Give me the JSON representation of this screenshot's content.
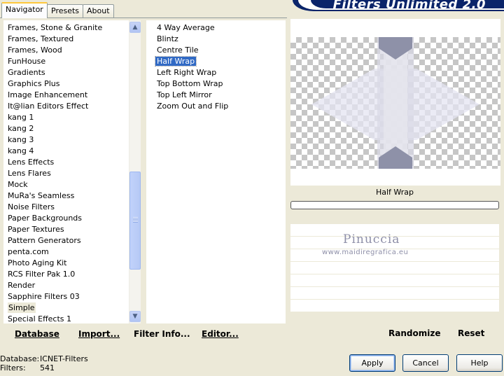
{
  "tabs": [
    {
      "label": "Navigator",
      "active": true
    },
    {
      "label": "Presets",
      "active": false
    },
    {
      "label": "About",
      "active": false
    }
  ],
  "banner": {
    "title": "Filters Unlimited 2.0"
  },
  "categories": [
    "Frames, Stone & Granite",
    "Frames, Textured",
    "Frames, Wood",
    "FunHouse",
    "Gradients",
    "Graphics Plus",
    "Image Enhancement",
    "It@lian Editors Effect",
    "kang 1",
    "kang 2",
    "kang 3",
    "kang 4",
    "Lens Effects",
    "Lens Flares",
    "Mock",
    "MuRa's Seamless",
    "Noise Filters",
    "Paper Backgrounds",
    "Paper Textures",
    "Pattern Generators",
    "penta.com",
    "Photo Aging Kit",
    "RCS Filter Pak 1.0",
    "Render",
    "Sapphire Filters 03",
    "Simple",
    "Special Effects 1"
  ],
  "selected_category": "Simple",
  "filters": [
    "4 Way Average",
    "Blintz",
    "Centre Tile",
    "Half Wrap",
    "Left Right Wrap",
    "Top Bottom Wrap",
    "Top Left Mirror",
    "Zoom Out and Flip"
  ],
  "selected_filter": "Half Wrap",
  "left_buttons": {
    "database": "Database",
    "import": "Import...",
    "filter_info": "Filter Info...",
    "editor": "Editor..."
  },
  "preview": {
    "filter_name": "Half Wrap"
  },
  "watermark": {
    "name": "Pinuccia",
    "url": "www.maidiregrafica.eu"
  },
  "right_buttons": {
    "randomize": "Randomize",
    "reset": "Reset"
  },
  "status": {
    "database_label": "Database:",
    "database_value": "ICNET-Filters",
    "filters_label": "Filters:",
    "filters_value": "541"
  },
  "dialog_buttons": {
    "apply": "Apply",
    "cancel": "Cancel",
    "help": "Help"
  },
  "colors": {
    "selection": "#316ac5",
    "banner": "#0a246a",
    "preview_shape": "#8e91a8"
  }
}
